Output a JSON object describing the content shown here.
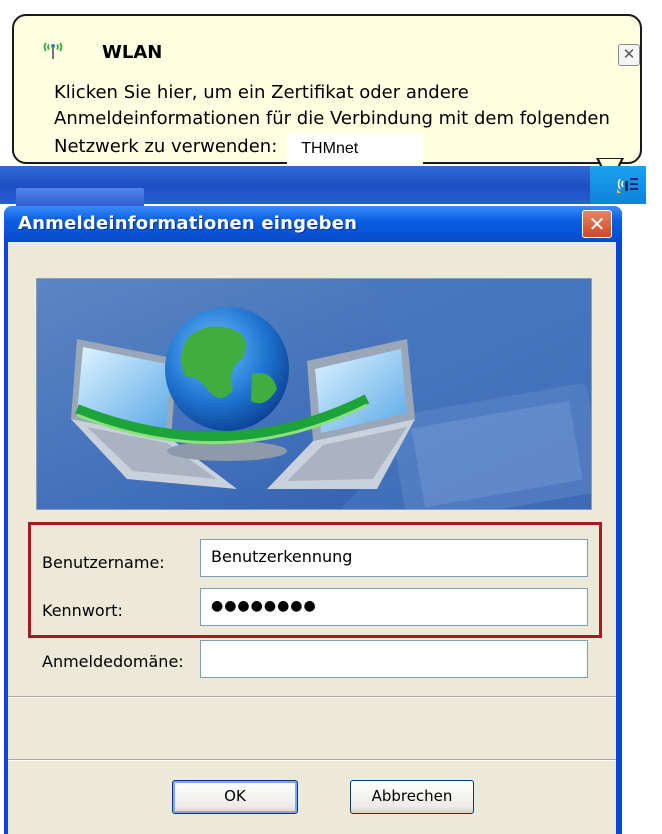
{
  "balloon": {
    "title": "WLAN",
    "close_glyph": "✕",
    "line1": "Klicken Sie hier, um ein Zertifikat oder andere",
    "line2": "Anmeldeinformationen für die Verbindung mit dem folgenden",
    "line3": "Netzwerk zu verwenden:",
    "network_name": "THMnet",
    "icon": "wireless-network-icon"
  },
  "dialog": {
    "title": "Anmeldeinformationen eingeben",
    "close_glyph": "✕",
    "banner_icon": "network-globe-laptops-icon",
    "fields": {
      "username_label": "Benutzername:",
      "username_value": "Benutzerkennung",
      "password_label": "Kennwort:",
      "password_value": "●●●●●●●●",
      "domain_label": "Anmeldedomäne:",
      "domain_value": ""
    },
    "buttons": {
      "ok": "OK",
      "cancel": "Abbrechen"
    }
  },
  "colors": {
    "balloon_bg": "#ffffe1",
    "title_bar": "#0a5fe0",
    "dialog_face": "#ece9d8",
    "highlight_border": "#a41c22"
  }
}
